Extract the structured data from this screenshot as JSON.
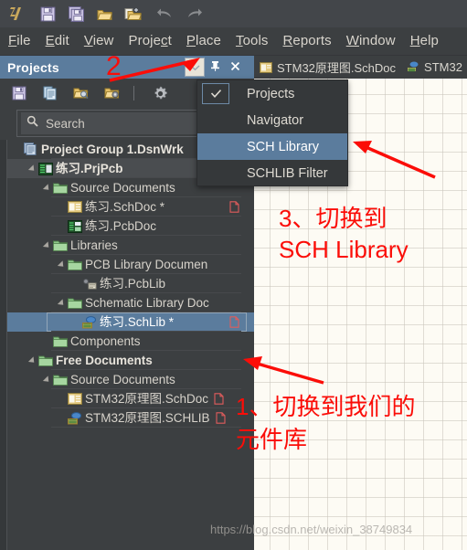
{
  "toolbar": {
    "icons": [
      {
        "name": "altium-logo-icon",
        "label": "Altium"
      },
      {
        "name": "save-icon",
        "label": "Save"
      },
      {
        "name": "save-all-icon",
        "label": "Save All"
      },
      {
        "name": "open-folder-icon",
        "label": "Open"
      },
      {
        "name": "open-project-icon",
        "label": "Open Project"
      },
      {
        "name": "undo-icon",
        "label": "Undo"
      },
      {
        "name": "redo-icon",
        "label": "Redo"
      }
    ]
  },
  "menubar": {
    "items": [
      {
        "pre": "",
        "mn": "F",
        "post": "ile"
      },
      {
        "pre": "",
        "mn": "E",
        "post": "dit"
      },
      {
        "pre": "",
        "mn": "V",
        "post": "iew"
      },
      {
        "pre": "Proje",
        "mn": "c",
        "post": "t"
      },
      {
        "pre": "",
        "mn": "P",
        "post": "lace"
      },
      {
        "pre": "",
        "mn": "T",
        "post": "ools"
      },
      {
        "pre": "",
        "mn": "R",
        "post": "eports"
      },
      {
        "pre": "",
        "mn": "W",
        "post": "indow"
      },
      {
        "pre": "",
        "mn": "H",
        "post": "elp"
      }
    ]
  },
  "tabs": [
    {
      "label": "STM32原理图.SchDoc",
      "icon": "schdoc-icon"
    },
    {
      "label": "STM32",
      "icon": "schlib-icon"
    }
  ],
  "panel": {
    "title": "Projects",
    "buttons": [
      {
        "name": "panel-dropdown-button",
        "icon": "chevron-down-icon",
        "active": true
      },
      {
        "name": "panel-pin-button",
        "icon": "pin-icon",
        "active": false
      },
      {
        "name": "panel-close-button",
        "icon": "close-icon",
        "active": false
      }
    ],
    "toolbar_icons": [
      {
        "name": "save-icon"
      },
      {
        "name": "documents-icon"
      },
      {
        "name": "open-project-search-icon"
      },
      {
        "name": "project-options-icon"
      },
      {
        "name": "gear-icon"
      }
    ],
    "search": {
      "placeholder": "Search",
      "value": ""
    }
  },
  "tree": {
    "rows": [
      {
        "depth": 0,
        "arrow": "none",
        "icon": "project-group-icon",
        "label": "Project Group 1.DsnWrk",
        "bold": true,
        "state": "none",
        "redfile": false
      },
      {
        "depth": 1,
        "arrow": "open",
        "icon": "prjpcb-icon",
        "label": "练习.PrjPcb",
        "bold": true,
        "state": "selected-project",
        "redfile": false
      },
      {
        "depth": 2,
        "arrow": "open",
        "icon": "folder-icon",
        "label": "Source Documents",
        "bold": false,
        "state": "none",
        "redfile": false
      },
      {
        "depth": 3,
        "arrow": "none",
        "icon": "schdoc-icon",
        "label": "练习.SchDoc *",
        "bold": false,
        "state": "none",
        "redfile": true
      },
      {
        "depth": 3,
        "arrow": "none",
        "icon": "pcbdoc-icon",
        "label": "练习.PcbDoc",
        "bold": false,
        "state": "none",
        "redfile": false
      },
      {
        "depth": 2,
        "arrow": "open",
        "icon": "folder-icon",
        "label": "Libraries",
        "bold": false,
        "state": "none",
        "redfile": false
      },
      {
        "depth": 3,
        "arrow": "open",
        "icon": "folder-icon",
        "label": "PCB Library Documen",
        "bold": false,
        "state": "none",
        "redfile": false
      },
      {
        "depth": 4,
        "arrow": "none",
        "icon": "pcblib-icon",
        "label": "练习.PcbLib",
        "bold": false,
        "state": "none",
        "redfile": false
      },
      {
        "depth": 3,
        "arrow": "open",
        "icon": "folder-icon",
        "label": "Schematic Library Doc",
        "bold": false,
        "state": "none",
        "redfile": false
      },
      {
        "depth": 4,
        "arrow": "none",
        "icon": "schlib-icon",
        "label": "练习.SchLib *",
        "bold": false,
        "state": "selected-lib",
        "redfile": true
      },
      {
        "depth": 2,
        "arrow": "none",
        "icon": "folder-icon",
        "label": "Components",
        "bold": false,
        "state": "none",
        "redfile": false
      },
      {
        "depth": 1,
        "arrow": "open",
        "icon": "folder-icon",
        "label": "Free Documents",
        "bold": true,
        "state": "none",
        "redfile": false
      },
      {
        "depth": 2,
        "arrow": "open",
        "icon": "folder-icon",
        "label": "Source Documents",
        "bold": false,
        "state": "none",
        "redfile": false
      },
      {
        "depth": 3,
        "arrow": "none",
        "icon": "schdoc-icon",
        "label": "STM32原理图.SchDoc",
        "bold": false,
        "state": "none",
        "redfile": "inline"
      },
      {
        "depth": 3,
        "arrow": "none",
        "icon": "schlib-icon",
        "label": "STM32原理图.SCHLIB",
        "bold": false,
        "state": "none",
        "redfile": "inline"
      }
    ]
  },
  "dropdown": {
    "items": [
      {
        "label": "Projects",
        "checked": true,
        "highlighted": false
      },
      {
        "label": "Navigator",
        "checked": false,
        "highlighted": false
      },
      {
        "label": "SCH Library",
        "checked": false,
        "highlighted": true
      },
      {
        "label": "SCHLIB Filter",
        "checked": false,
        "highlighted": false
      }
    ]
  },
  "annotations": {
    "step2": "2",
    "step3_line1": "3、切换到",
    "step3_line2": "SCH Library",
    "step1_line1": "1、切换到我们的",
    "step1_line2": "元件库"
  },
  "watermark": "https://blog.csdn.net/weixin_38749834",
  "colors": {
    "accent": "#5b7c9d",
    "annotation": "#fb0d08",
    "panel_bg": "#3c3f41",
    "canvas_bg": "#fdfbf4"
  }
}
